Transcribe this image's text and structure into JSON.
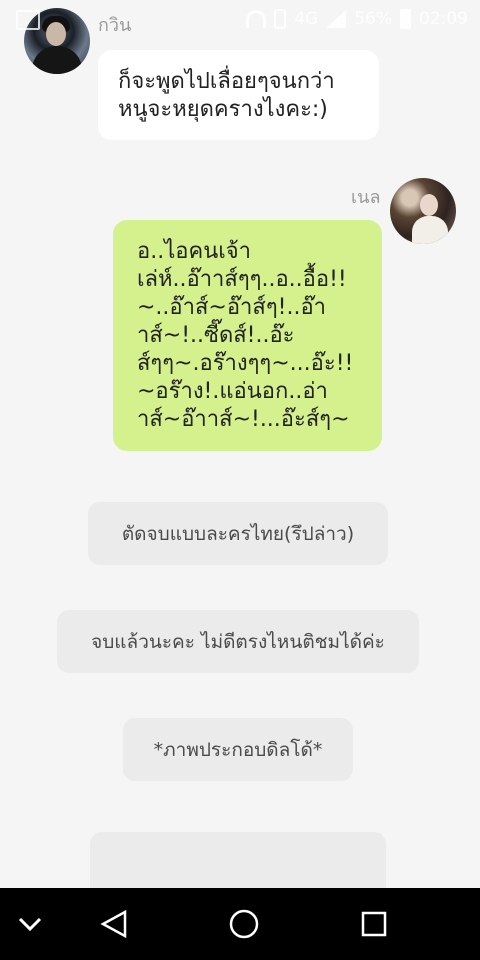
{
  "status_bar": {
    "network": "4G",
    "battery": "56%",
    "time": "02:09"
  },
  "chat": {
    "messages": [
      {
        "sender": "กวิน",
        "side": "left",
        "text": "ก็จะพูดไปเลื่อยๆจนกว่าหนูจะหยุดครางไงคะ:)"
      },
      {
        "sender": "เนล",
        "side": "right",
        "text": "อ..ไอคนเจ้า\nเล่ห์..อ๊าาส์ๆๆ..อ..อื้อ!!\n~..อ๊าส์~อ๊าส์ๆ!..อ๊า\nาส์~!..ซี๊ดส์!..อ๊ะ\nส์ๆๆ~.อร๊างๆๆ~...อ๊ะ!!\n~อร๊าง!.แอ่นอก..อ่า\nาส์~อ๊าาส์~!...อ๊ะส์ๆ~"
      }
    ],
    "choices": [
      "ตัดจบแบบละครไทย(รึปล่าว)",
      "จบแล้วนะคะ ไม่ดีตรงไหนติชมได้ค่ะ",
      "*ภาพประกอบดิลโด้*",
      ""
    ]
  },
  "icons": {
    "status": [
      "image-icon",
      "headset-icon",
      "vibrate-icon",
      "signal-icon",
      "battery-icon"
    ],
    "nav": [
      "collapse-icon",
      "back-icon",
      "home-icon",
      "recent-apps-icon"
    ]
  },
  "colors": {
    "background": "#f5f5f5",
    "incoming_bubble": "#ffffff",
    "outgoing_bubble": "#d4f18e",
    "choice_bubble": "#ebebeb",
    "nav_bar": "#000000"
  }
}
